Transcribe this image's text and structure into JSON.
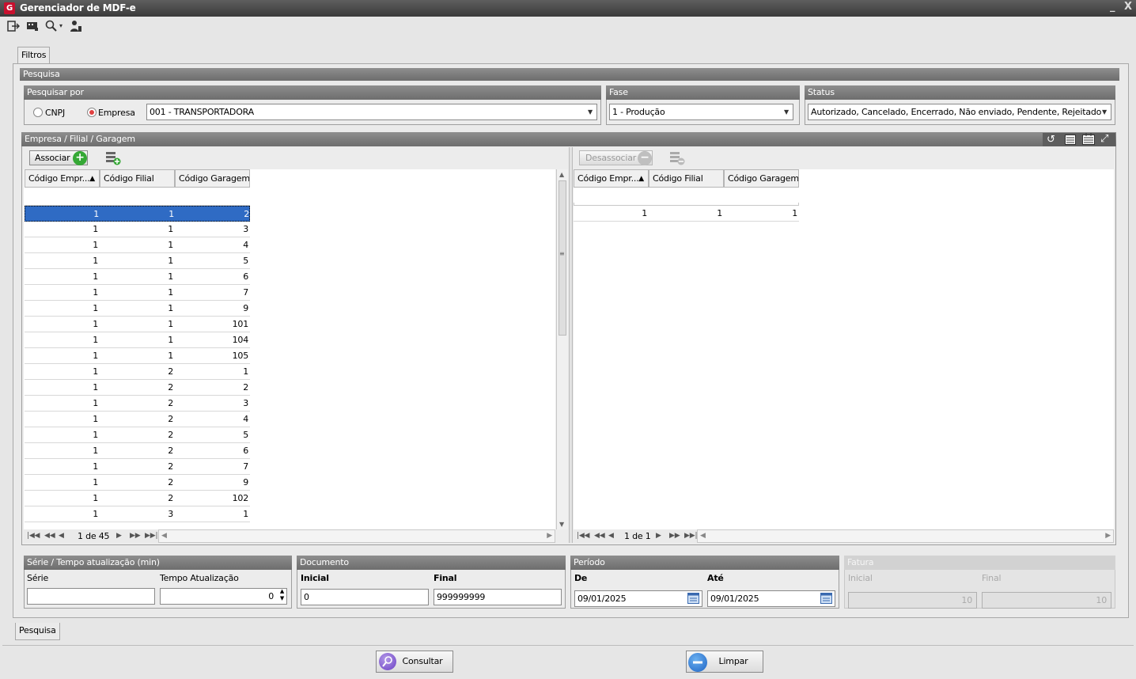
{
  "window": {
    "title": "Gerenciador de MDF-e",
    "logo": "G",
    "min": "_",
    "close": "X"
  },
  "toolbar": {
    "icons": [
      "exit-icon",
      "message-icon",
      "search-icon",
      "user-icon"
    ],
    "search_arrow": "▾"
  },
  "tabs": {
    "top": "Filtros",
    "bottom": "Pesquisa"
  },
  "pesquisa": {
    "header": "Pesquisa",
    "pesquisar_por": {
      "header": "Pesquisar por",
      "options": [
        "CNPJ",
        "Empresa"
      ],
      "selected": "Empresa",
      "value": "001 - TRANSPORTADORA"
    },
    "fase": {
      "header": "Fase",
      "value": "1 - Produção"
    },
    "status": {
      "header": "Status",
      "value": "Autorizado, Cancelado, Encerrado, Não enviado, Pendente, Rejeitado"
    }
  },
  "empresa_panel": {
    "header": "Empresa / Filial / Garagem",
    "associar": "Associar",
    "desassociar": "Desassociar",
    "left_columns": [
      "Código Empr...",
      "Código Filial",
      "Código Garagem"
    ],
    "left_rows": [
      [
        "1",
        "1",
        "2"
      ],
      [
        "1",
        "1",
        "3"
      ],
      [
        "1",
        "1",
        "4"
      ],
      [
        "1",
        "1",
        "5"
      ],
      [
        "1",
        "1",
        "6"
      ],
      [
        "1",
        "1",
        "7"
      ],
      [
        "1",
        "1",
        "9"
      ],
      [
        "1",
        "1",
        "101"
      ],
      [
        "1",
        "1",
        "104"
      ],
      [
        "1",
        "1",
        "105"
      ],
      [
        "1",
        "2",
        "1"
      ],
      [
        "1",
        "2",
        "2"
      ],
      [
        "1",
        "2",
        "3"
      ],
      [
        "1",
        "2",
        "4"
      ],
      [
        "1",
        "2",
        "5"
      ],
      [
        "1",
        "2",
        "6"
      ],
      [
        "1",
        "2",
        "7"
      ],
      [
        "1",
        "2",
        "9"
      ],
      [
        "1",
        "2",
        "102"
      ],
      [
        "1",
        "3",
        "1"
      ]
    ],
    "left_page": "1 de 45",
    "right_columns": [
      "Código Empr...",
      "Código Filial",
      "Código Garagem"
    ],
    "right_rows": [
      [
        "1",
        "1",
        "1"
      ]
    ],
    "right_page": "1 de 1",
    "sort_mark": "▲"
  },
  "serie": {
    "header": "Série / Tempo atualização (min)",
    "serie_label": "Série",
    "serie_value": "",
    "tempo_label": "Tempo Atualização",
    "tempo_value": "0"
  },
  "documento": {
    "header": "Documento",
    "inicial_label": "Inicial",
    "inicial_value": "0",
    "final_label": "Final",
    "final_value": "999999999"
  },
  "periodo": {
    "header": "Período",
    "de_label": "De",
    "de_value": "09/01/2025",
    "ate_label": "Até",
    "ate_value": "09/01/2025"
  },
  "fatura": {
    "header": "Fatura",
    "inicial_label": "Inicial",
    "inicial_value": "10",
    "final_label": "Final",
    "final_value": "10"
  },
  "footer": {
    "consultar": "Consultar",
    "limpar": "Limpar"
  },
  "colors": {
    "header_gray": "#7a7a7a",
    "selection": "#2f6bc4",
    "title_bar": "#4a4a4a",
    "logo": "#c8102e"
  }
}
